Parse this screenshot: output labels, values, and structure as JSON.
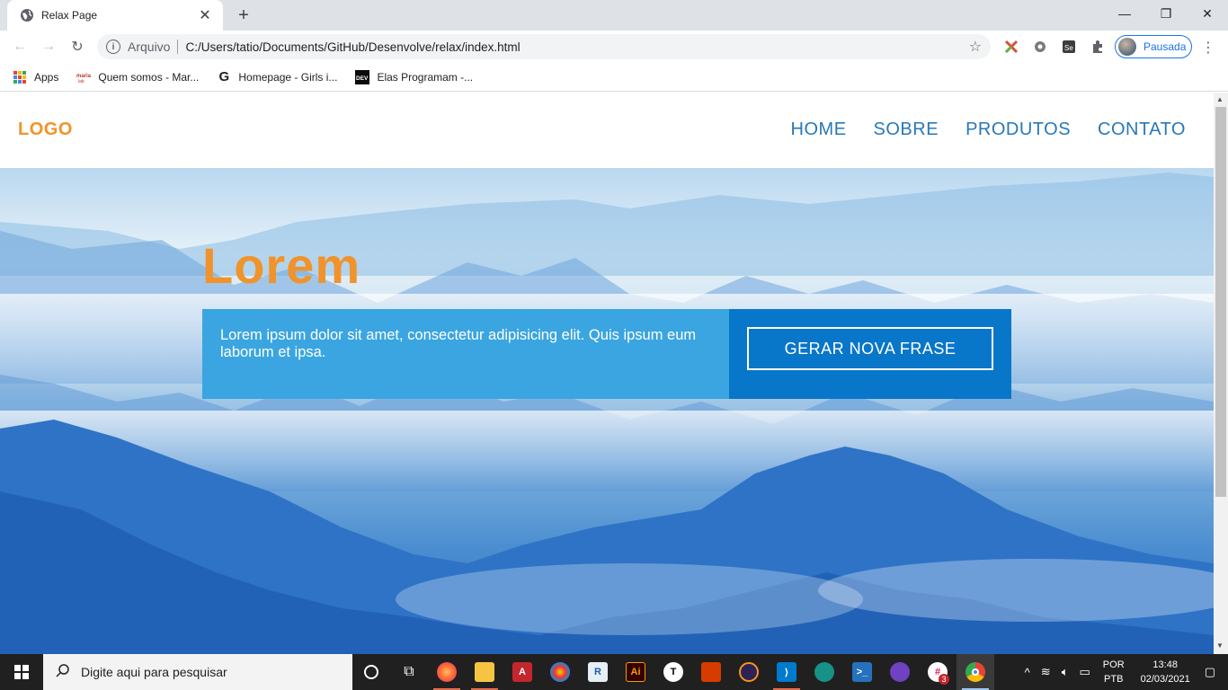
{
  "browser": {
    "tab_title": "Relax Page",
    "omnibox_label": "Arquivo",
    "url": "C:/Users/tatio/Documents/GitHub/Desenvolve/relax/index.html",
    "profile_label": "Pausada",
    "bookmarks": [
      {
        "label": "Apps",
        "icon": "apps-grid-icon"
      },
      {
        "label": "Quem somos - Mar...",
        "icon": "maria-icon"
      },
      {
        "label": "Homepage - Girls i...",
        "icon": "g-icon"
      },
      {
        "label": "Elas Programam -...",
        "icon": "dev-icon"
      }
    ],
    "icons": [
      "globe-icon",
      "close-icon",
      "plus-icon",
      "minimize-icon",
      "restore-icon",
      "back-icon",
      "forward-icon",
      "reload-icon",
      "info-icon",
      "star-icon",
      "puzzle-icon",
      "menu-dots-icon"
    ]
  },
  "site": {
    "logo": "LOGO",
    "nav": [
      "HOME",
      "SOBRE",
      "PRODUTOS",
      "CONTATO"
    ],
    "hero_title": "Lorem",
    "quote": "Lorem ipsum dolor sit amet, consectetur adipisicing elit. Quis ipsum eum laborum et ipsa.",
    "button_label": "GERAR NOVA FRASE"
  },
  "taskbar": {
    "search_placeholder": "Digite aqui para pesquisar",
    "lang_top": "POR",
    "lang_bottom": "PTB",
    "time": "13:48",
    "date": "02/03/2021",
    "badge_count": "3"
  },
  "colors": {
    "accent_orange": "#f0932b",
    "nav_blue": "#2878b8",
    "quote_blue": "#3aa5e0",
    "button_blue": "#0876c9"
  }
}
